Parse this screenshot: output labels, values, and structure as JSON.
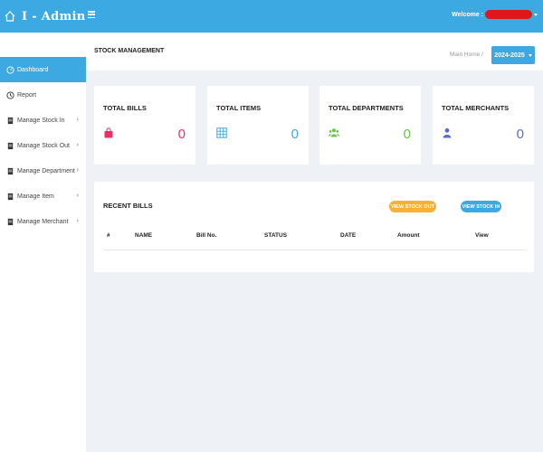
{
  "brand": {
    "title": "I - Admin"
  },
  "topbar": {
    "welcome": "Welcome :"
  },
  "sidebar": {
    "items": [
      {
        "label": "Dashboard",
        "icon": "dashboard-icon",
        "active": true
      },
      {
        "label": "Report",
        "icon": "report-icon"
      },
      {
        "label": "Manage Stock In",
        "icon": "document-icon"
      },
      {
        "label": "Manage Stock Out",
        "icon": "document-icon"
      },
      {
        "label": "Manage Department",
        "icon": "document-icon"
      },
      {
        "label": "Manage Item",
        "icon": "document-icon"
      },
      {
        "label": "Manage Merchant",
        "icon": "document-icon"
      }
    ]
  },
  "header": {
    "title": "STOCK MANAGEMENT",
    "breadcrumb": "Main Home /",
    "year": "2024-2025"
  },
  "cards": [
    {
      "label": "TOTAL BILLS",
      "value": "0",
      "icon": "shopping-bag-icon",
      "color": "#e5326a"
    },
    {
      "label": "TOTAL ITEMS",
      "value": "0",
      "icon": "grid-icon",
      "color": "#3ca9e2"
    },
    {
      "label": "TOTAL DEPARTMENTS",
      "value": "0",
      "icon": "users-icon",
      "color": "#6cc24a"
    },
    {
      "label": "TOTAL MERCHANTS",
      "value": "0",
      "icon": "user-icon",
      "color": "#5b6cc6"
    }
  ],
  "bills": {
    "title": "RECENT BILLS",
    "btn_out": "VIEW STOCK OUT",
    "btn_in": "VIEW STOCK IN",
    "columns": [
      "#",
      "NAME",
      "Bill No.",
      "STATUS",
      "DATE",
      "Amount",
      "View"
    ]
  }
}
